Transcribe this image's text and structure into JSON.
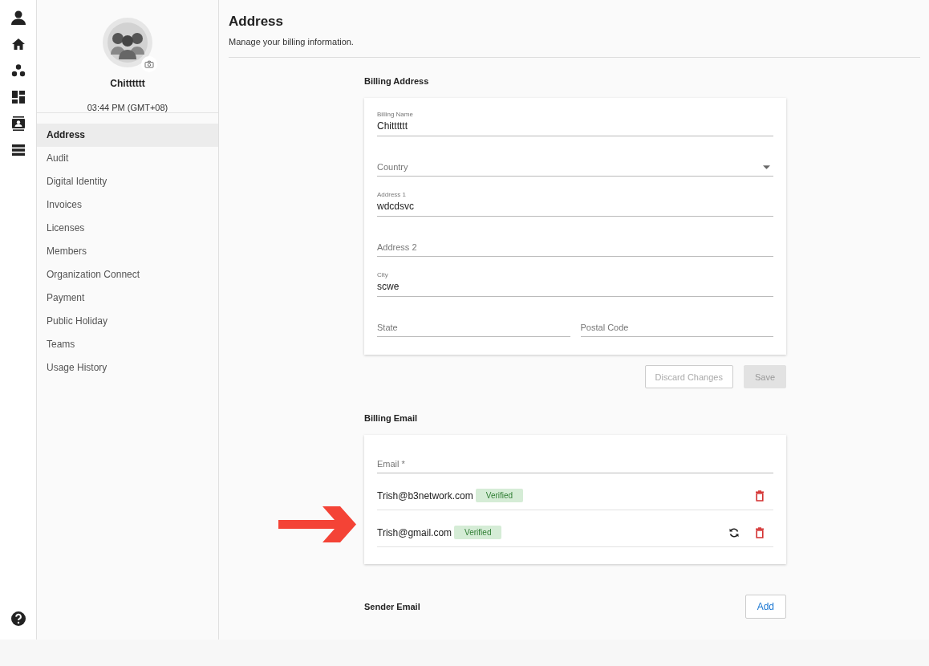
{
  "profile": {
    "name": "Chitttttt",
    "time": "03:44 PM (GMT+08)"
  },
  "sidebar": {
    "items": [
      {
        "label": "Address",
        "selected": true
      },
      {
        "label": "Audit",
        "selected": false
      },
      {
        "label": "Digital Identity",
        "selected": false
      },
      {
        "label": "Invoices",
        "selected": false
      },
      {
        "label": "Licenses",
        "selected": false
      },
      {
        "label": "Members",
        "selected": false
      },
      {
        "label": "Organization Connect",
        "selected": false
      },
      {
        "label": "Payment",
        "selected": false
      },
      {
        "label": "Public Holiday",
        "selected": false
      },
      {
        "label": "Teams",
        "selected": false
      },
      {
        "label": "Usage History",
        "selected": false
      }
    ]
  },
  "page": {
    "title": "Address",
    "subtitle": "Manage your billing information."
  },
  "billing_address": {
    "heading": "Billing Address",
    "fields": [
      {
        "kind": "text",
        "label": "Billing Name",
        "value": "Chitttttt"
      },
      {
        "kind": "select",
        "placeholder": "Country"
      },
      {
        "kind": "text",
        "label": "Address 1",
        "value": "wdcdsvc"
      },
      {
        "kind": "text",
        "placeholder": "Address 2"
      },
      {
        "kind": "text",
        "label": "City",
        "value": "scwe"
      },
      {
        "kind": "pair",
        "fields": [
          {
            "kind": "text",
            "placeholder": "State"
          },
          {
            "kind": "text",
            "placeholder": "Postal Code"
          }
        ]
      }
    ],
    "buttons": [
      {
        "kind": "outline",
        "label": "Discard Changes",
        "disabled": true
      },
      {
        "kind": "filled",
        "label": "Save",
        "disabled": true
      }
    ]
  },
  "billing_email": {
    "heading": "Billing Email",
    "field": {
      "placeholder": "Email *"
    },
    "emails": [
      {
        "address": "Trish@b3network.com",
        "badge": "Verified",
        "resend": false
      },
      {
        "address": "Trish@gmail.com",
        "badge": "Verified",
        "resend": true
      }
    ]
  },
  "sender_email": {
    "heading": "Sender Email",
    "button": "Add"
  }
}
